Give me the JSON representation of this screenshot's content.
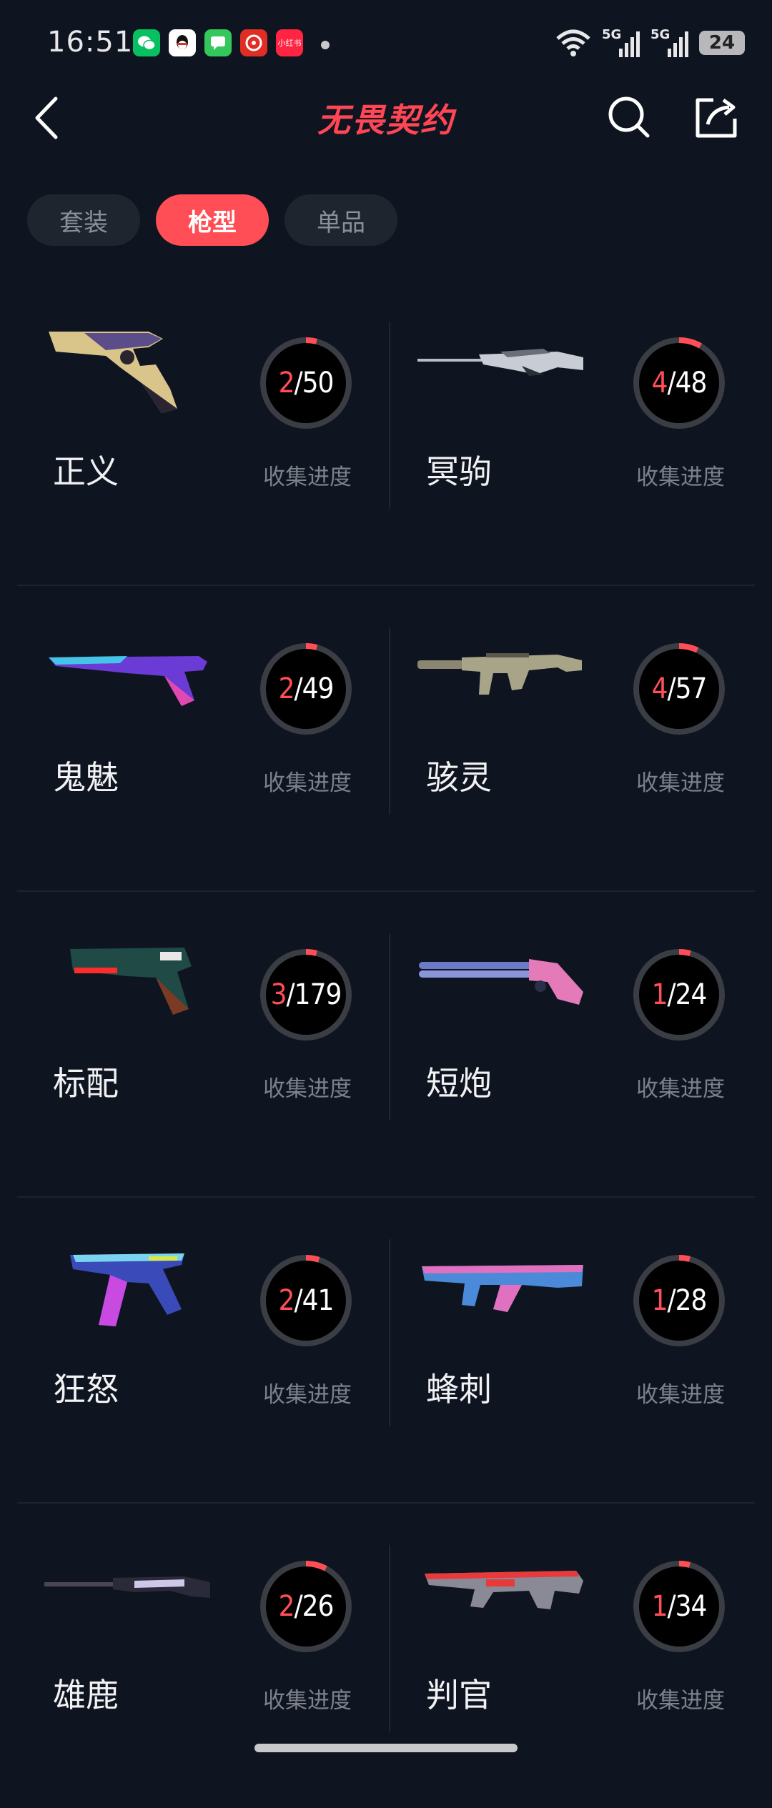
{
  "status_bar": {
    "time": "16:51",
    "battery": "24",
    "signal_1": "5G",
    "signal_2": "5G",
    "notification_apps": [
      {
        "name": "wechat-icon",
        "color": "#07c160"
      },
      {
        "name": "qq-icon",
        "color": "#ffffff"
      },
      {
        "name": "messages-icon",
        "color": "#34c759"
      },
      {
        "name": "pinduoduo-icon",
        "color": "#e02e24"
      },
      {
        "name": "xiaohongshu-icon",
        "color": "#ff2442"
      }
    ],
    "xiaohongshu_label": "小红书"
  },
  "header": {
    "title": "无畏契约",
    "accent_color": "#ff4655"
  },
  "tabs": [
    {
      "label": "套装",
      "active": false
    },
    {
      "label": "枪型",
      "active": true
    },
    {
      "label": "单品",
      "active": false
    }
  ],
  "weapons": [
    {
      "name": "正义",
      "collected": "2",
      "total": "50",
      "progress": 0.04,
      "label": "收集进度"
    },
    {
      "name": "冥驹",
      "collected": "4",
      "total": "48",
      "progress": 0.083,
      "label": "收集进度"
    },
    {
      "name": "鬼魅",
      "collected": "2",
      "total": "49",
      "progress": 0.041,
      "label": "收集进度"
    },
    {
      "name": "骇灵",
      "collected": "4",
      "total": "57",
      "progress": 0.07,
      "label": "收集进度"
    },
    {
      "name": "标配",
      "collected": "3",
      "total": "179",
      "progress": 0.017,
      "label": "收集进度"
    },
    {
      "name": "短炮",
      "collected": "1",
      "total": "24",
      "progress": 0.042,
      "label": "收集进度"
    },
    {
      "name": "狂怒",
      "collected": "2",
      "total": "41",
      "progress": 0.049,
      "label": "收集进度"
    },
    {
      "name": "蜂刺",
      "collected": "1",
      "total": "28",
      "progress": 0.036,
      "label": "收集进度"
    },
    {
      "name": "雄鹿",
      "collected": "2",
      "total": "26",
      "progress": 0.077,
      "label": "收集进度"
    },
    {
      "name": "判官",
      "collected": "1",
      "total": "34",
      "progress": 0.029,
      "label": "收集进度"
    }
  ]
}
